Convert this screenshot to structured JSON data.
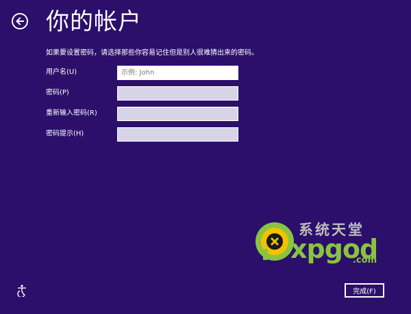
{
  "header": {
    "title": "你的帐户"
  },
  "instruction": "如果要设置密码，请选择那些你容易记住但是别人很难猜出来的密码。",
  "form": {
    "fields": [
      {
        "label": "用户名(U)",
        "value": "",
        "placeholder": "示例: John"
      },
      {
        "label": "密码(P)",
        "value": "",
        "placeholder": ""
      },
      {
        "label": "重新输入密码(R)",
        "value": "",
        "placeholder": ""
      },
      {
        "label": "密码提示(H)",
        "value": "",
        "placeholder": ""
      }
    ]
  },
  "footer": {
    "finish_label": "完成(F)"
  },
  "watermark": {
    "chinese": "系统天堂",
    "brand": "xpgod",
    "domain": ".com"
  },
  "colors": {
    "background": "#2b0f6b",
    "field_fill": "#d8d4e8",
    "brand_green": "#8ac43f"
  },
  "icons": {
    "back": "back-arrow-icon",
    "accessibility": "ease-of-access-icon"
  }
}
